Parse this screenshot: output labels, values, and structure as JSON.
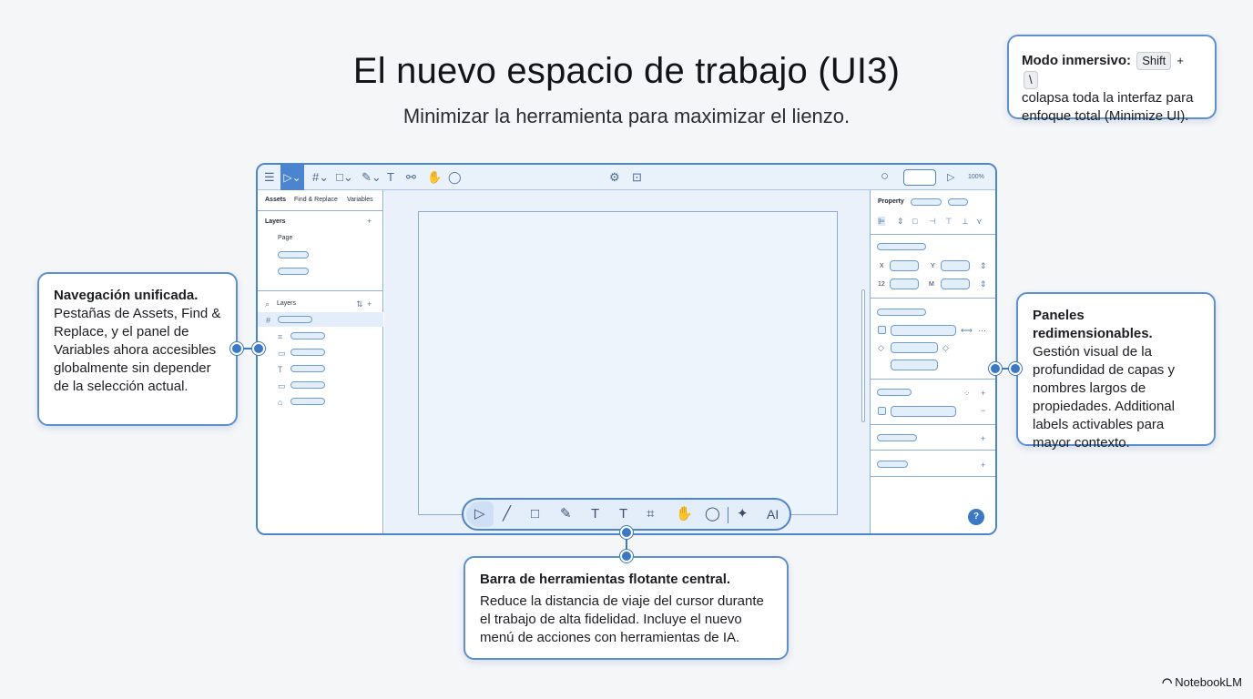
{
  "header": {
    "title": "El nuevo espacio de trabajo (UI3)",
    "subtitle": "Minimizar la herramienta para maximizar el lienzo."
  },
  "callouts": {
    "immersive": {
      "head": "Modo inmersivo:",
      "key1": "Shift",
      "plus": "+",
      "key2": "\\",
      "body": "colapsa toda la interfaz para enfoque total (Minimize UI)."
    },
    "navigation": {
      "head": "Navegación unificada.",
      "body": "Pestañas de Assets, Find & Replace, y el panel de Variables ahora accesibles globalmente sin depender de la selección actual."
    },
    "panels": {
      "head": "Paneles redimensionables.",
      "body": "Gestión visual de la profundidad de capas y nombres largos de propiedades. Additional labels activables para mayor contexto."
    },
    "toolbar": {
      "head": "Barra de herramientas flotante central.",
      "body": "Reduce la distancia de viaje del cursor durante el trabajo de alta fidelidad. Incluye el nuevo menú de acciones con herramientas de IA."
    }
  },
  "app": {
    "zoom": "100%",
    "tabs": [
      "Assets",
      "Find & Replace",
      "Variables"
    ],
    "layers_title": "Layers",
    "page_label": "Page",
    "layers_search_label": "Layers",
    "property_label": "Property",
    "x_label": "X",
    "y_label": "Y",
    "w_label": "12",
    "h_label": "M",
    "ai_label": "AI",
    "help": "?"
  },
  "brand": {
    "name": "NotebookLM"
  },
  "colors": {
    "accent": "#3b78c6",
    "panel_border": "#4b84cf",
    "canvas": "#eaf1fa"
  }
}
